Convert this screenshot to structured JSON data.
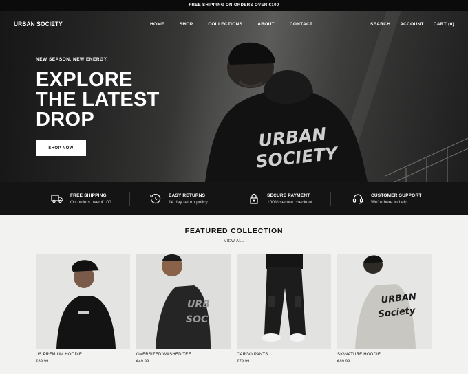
{
  "announcement": "FREE SHIPPING ON ORDERS OVER €100",
  "brand": "URBAN SOCIETY",
  "nav": {
    "links": [
      "HOME",
      "SHOP",
      "COLLECTIONS",
      "ABOUT",
      "CONTACT"
    ],
    "search": "SEARCH",
    "account": "ACCOUNT",
    "cart": "CART (0)"
  },
  "hero": {
    "kicker": "NEW SEASON. NEW ENERGY.",
    "headline_lines": [
      "EXPLORE",
      "THE LATEST",
      "DROP"
    ],
    "cta": "SHOP NOW",
    "graphic_text": [
      "URBAN",
      "SOCIETY"
    ]
  },
  "features": [
    {
      "icon": "truck-icon",
      "title": "FREE SHIPPING",
      "subtitle": "On orders over €100"
    },
    {
      "icon": "return-clock-icon",
      "title": "EASY RETURNS",
      "subtitle": "14 day return policy"
    },
    {
      "icon": "lock-icon",
      "title": "SECURE PAYMENT",
      "subtitle": "100% secure checkout"
    },
    {
      "icon": "headset-icon",
      "title": "CUSTOMER SUPPORT",
      "subtitle": "We're here to help"
    }
  ],
  "featured": {
    "title": "FEATURED COLLECTION",
    "view_all": "VIEW ALL",
    "products": [
      {
        "name": "US PREMIUM HOODIE",
        "price": "€89.99"
      },
      {
        "name": "OVERSIZED WASHED TEE",
        "price": "€49.99"
      },
      {
        "name": "CARGO PANTS",
        "price": "€79.99"
      },
      {
        "name": "SIGNATURE HOODIE",
        "price": "€89.99"
      }
    ]
  },
  "colors": {
    "announcement_bg": "#0b0b0b",
    "features_bg": "#141414",
    "page_bg": "#f2f2f0",
    "button_bg": "#ffffff"
  }
}
